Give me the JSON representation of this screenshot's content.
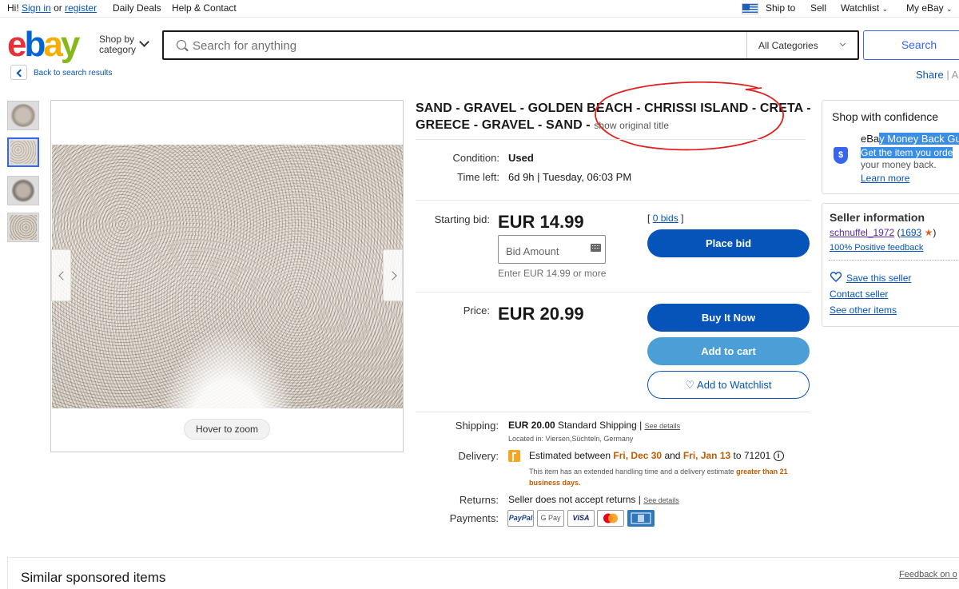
{
  "topnav": {
    "greeting": "Hi!",
    "sign_in": "Sign in",
    "or": "or",
    "register": "register",
    "daily_deals": "Daily Deals",
    "help_contact": "Help & Contact",
    "ship_to": "Ship to",
    "sell": "Sell",
    "watchlist": "Watchlist",
    "my_ebay": "My eBay"
  },
  "header": {
    "logo": {
      "e": "e",
      "b": "b",
      "a": "a",
      "y": "y"
    },
    "shop_by_category": "Shop by category",
    "search_placeholder": "Search for anything",
    "category_selected": "All Categories",
    "search_button": "Search"
  },
  "nav": {
    "back": "Back to search results",
    "share": "Share"
  },
  "gallery": {
    "zoom_hint": "Hover to zoom",
    "thumbnail_count": 4,
    "selected_index": 2
  },
  "item": {
    "title": "SAND - GRAVEL - GOLDEN BEACH - CHRISSI ISLAND - CRETA - GREECE - GRAVEL - SAND - ",
    "show_original": "show original title",
    "condition_label": "Condition:",
    "condition": "Used",
    "time_left_label": "Time left:",
    "time_left": "6d 9h | Tuesday, 06:03 PM"
  },
  "bid": {
    "starting_label": "Starting bid:",
    "starting_price": "EUR 14.99",
    "bids_link": "0 bids",
    "bids_open": "[",
    "bids_close": "]",
    "amount_placeholder": "Bid Amount",
    "hint": "Enter EUR 14.99 or more",
    "place_bid": "Place bid"
  },
  "buy": {
    "price_label": "Price:",
    "price": "EUR 20.99",
    "buy_now": "Buy It Now",
    "add_to_cart": "Add to cart",
    "add_to_watchlist": "♡ Add to Watchlist"
  },
  "shipping": {
    "label": "Shipping:",
    "cost": "EUR 20.00",
    "method": " Standard Shipping | ",
    "details": "See details",
    "located": "Located in: Viersen,Süchteln, Germany"
  },
  "delivery": {
    "label": "Delivery:",
    "pre": "Estimated between ",
    "date1": "Fri, Dec 30",
    "and": " and ",
    "date2": "Fri, Jan 13",
    "post": " to 71201 ",
    "info": "i",
    "note_pre": "This item has an extended handling time and a delivery estimate ",
    "note_orange": "greater than 21",
    "note_line2": "business days."
  },
  "returns": {
    "label": "Returns:",
    "value": "Seller does not accept returns | ",
    "details": "See details"
  },
  "payments": {
    "label": "Payments:",
    "methods": [
      "PayPal",
      "G Pay",
      "VISA",
      "",
      ""
    ]
  },
  "confidence": {
    "title": "Shop with confidence",
    "guarantee_pre": "eBa",
    "guarantee_hl": "y Money Back Gu",
    "line2_hl": "Get the item you orde",
    "line3": "your money back.",
    "learn_more": "Learn more",
    "shield_glyph": "$"
  },
  "seller": {
    "title": "Seller information",
    "name": "schnuffel_1972",
    "score_open": " (",
    "score": "1693",
    "star": "★",
    "score_close": ")",
    "feedback": "100% Positive feedback",
    "save": "Save this seller",
    "contact": "Contact seller",
    "other_items": "See other items"
  },
  "footer": {
    "similar": "Similar sponsored items",
    "feedback": "Feedback on o"
  },
  "colors": {
    "link": "#0654ba",
    "primary_button": "#0654ba",
    "cart_button": "#4b9fd6",
    "annotation_circle": "#e02020",
    "delivery_date": "#c25c00"
  }
}
